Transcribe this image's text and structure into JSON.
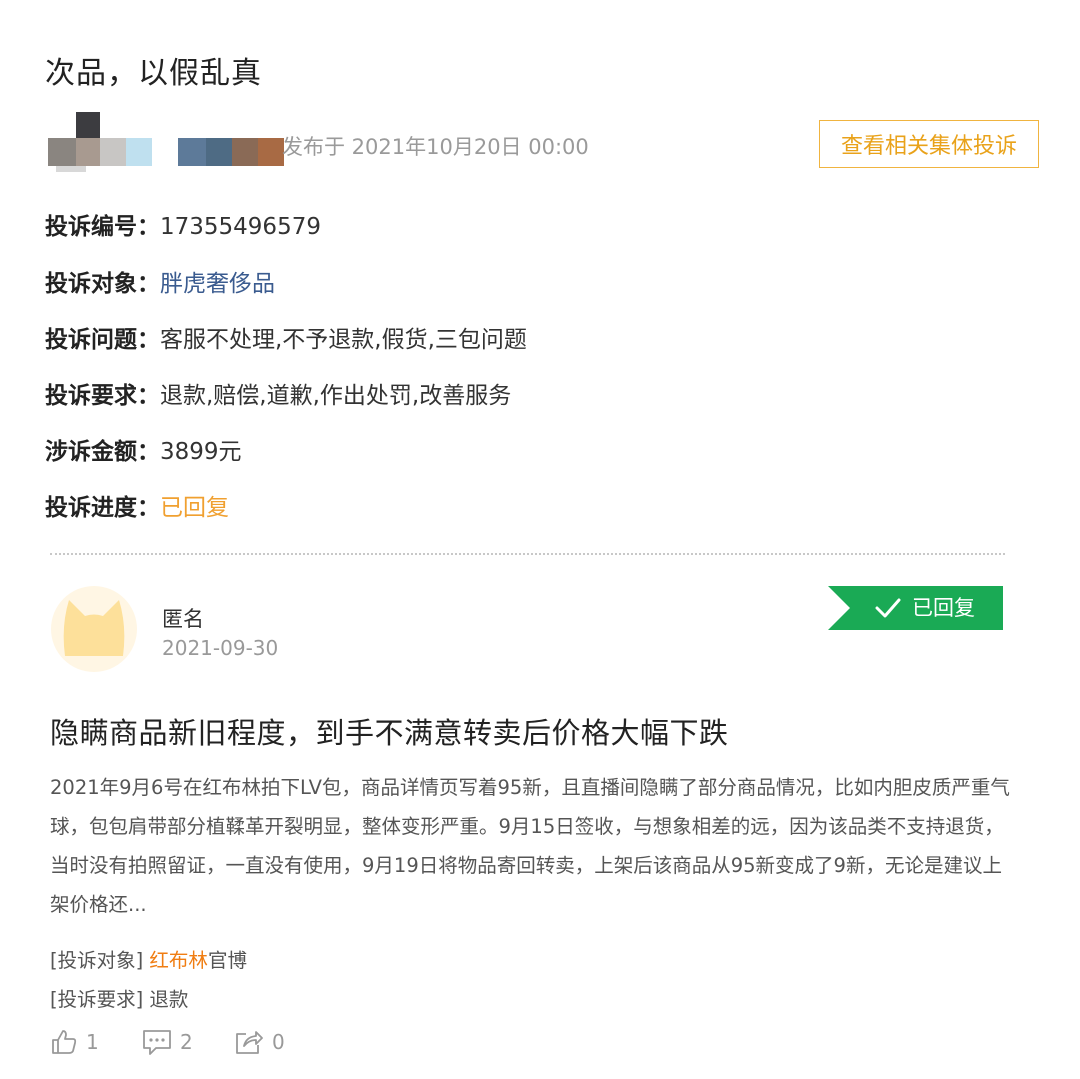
{
  "title": "次品，以假乱真",
  "publish_text": "发布于 2021年10月20日 00:00",
  "collective_button": "查看相关集体投诉",
  "complaint": {
    "id_label": "投诉编号：",
    "id": "17355496579",
    "target_label": "投诉对象：",
    "target": "胖虎奢侈品",
    "issue_label": "投诉问题：",
    "issue": "客服不处理,不予退款,假货,三包问题",
    "request_label": "投诉要求：",
    "request": "退款,赔偿,道歉,作出处罚,改善服务",
    "amount_label": "涉诉金额：",
    "amount": "3899元",
    "progress_label": "投诉进度：",
    "progress": "已回复"
  },
  "post": {
    "user": "匿名",
    "date": "2021-09-30",
    "badge": "已回复",
    "title": "隐瞒商品新旧程度，到手不满意转卖后价格大幅下跌",
    "body": "2021年9月6号在红布林拍下LV包，商品详情页写着95新，且直播间隐瞒了部分商品情况，比如内胆皮质严重气球，包包肩带部分植鞣革开裂明显，整体变形严重。9月15日签收，与想象相差的远，因为该品类不支持退货，当时没有拍照留证，一直没有使用，9月19日将物品寄回转卖，上架后该商品从95新变成了9新，无论是建议上架价格还...",
    "target_label": "[投诉对象]",
    "target_highlight": "红布林",
    "target_suffix": "官博",
    "request_label": "[投诉要求]",
    "request_value": "退款",
    "likes": "1",
    "comments": "2",
    "shares": "0"
  },
  "colors": {
    "accent": "#f0a030",
    "badge_green": "#1aaa55",
    "link_blue": "#3a5b8f",
    "highlight_orange": "#f07d12"
  },
  "icons": [
    "thumbs-up-icon",
    "comment-icon",
    "share-icon",
    "check-icon",
    "cat-avatar-icon"
  ]
}
